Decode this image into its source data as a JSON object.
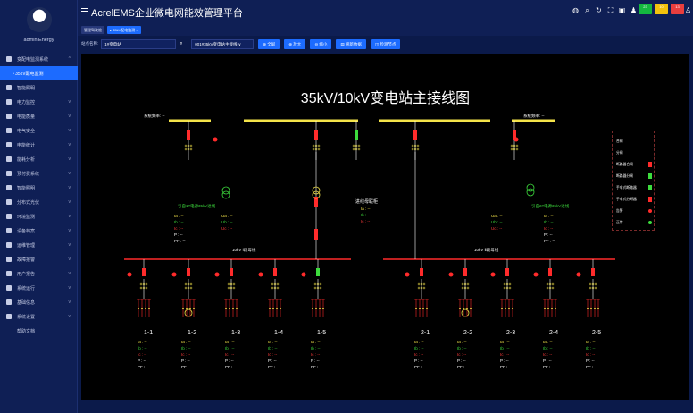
{
  "window": {
    "app_title": "AcrelEMS企业微电网能效管理平台",
    "user_name": "admin Energy"
  },
  "topbar": {
    "icons": [
      "globe-icon",
      "search-icon",
      "refresh-icon",
      "fullscreen-icon",
      "image-icon",
      "bell-icon"
    ],
    "badges": [
      {
        "label": "23",
        "color": "#14b83f"
      },
      {
        "label": "10",
        "color": "#f2c20d"
      },
      {
        "label": "13",
        "color": "#e83e3e"
      }
    ]
  },
  "sidebar": {
    "items": [
      {
        "label": "变配电监测系统",
        "icon": "home-icon",
        "chevron": "^"
      },
      {
        "label": "• 35kV配电监测",
        "icon": "",
        "chevron": "",
        "active": true,
        "sub": true
      },
      {
        "label": "智能照明",
        "icon": "bulb-icon",
        "chevron": ""
      },
      {
        "label": "电力监控",
        "icon": "monitor-icon",
        "chevron": "v"
      },
      {
        "label": "电能质量",
        "icon": "wave-icon",
        "chevron": "v"
      },
      {
        "label": "电气安全",
        "icon": "shield-icon",
        "chevron": "v"
      },
      {
        "label": "电能统计",
        "icon": "bar-chart-icon",
        "chevron": "v"
      },
      {
        "label": "能耗分析",
        "icon": "pie-icon",
        "chevron": "v"
      },
      {
        "label": "预付费系统",
        "icon": "card-icon",
        "chevron": "v"
      },
      {
        "label": "智能照明",
        "icon": "bulb-icon",
        "chevron": "v"
      },
      {
        "label": "分布式光伏",
        "icon": "solar-icon",
        "chevron": "v"
      },
      {
        "label": "环境监测",
        "icon": "tree-icon",
        "chevron": "v"
      },
      {
        "label": "设备档案",
        "icon": "folder-icon",
        "chevron": "v"
      },
      {
        "label": "运维管理",
        "icon": "tool-icon",
        "chevron": "v"
      },
      {
        "label": "故障报警",
        "icon": "alarm-icon",
        "chevron": "v"
      },
      {
        "label": "用户报告",
        "icon": "report-icon",
        "chevron": "v"
      },
      {
        "label": "系统运行",
        "icon": "run-icon",
        "chevron": "v"
      },
      {
        "label": "基础信息",
        "icon": "info-icon",
        "chevron": "v"
      },
      {
        "label": "系统设置",
        "icon": "settings-icon",
        "chevron": "v"
      },
      {
        "label": "帮助文档",
        "icon": "",
        "chevron": "",
        "plain": true
      }
    ]
  },
  "tabs": [
    {
      "label": "管理驾驶舱",
      "active": false
    },
    {
      "label": "▸ 35kV配电监测 ×",
      "active": true
    }
  ],
  "toolbar": {
    "station_label": "站点名称:",
    "station_value": "1#变电站",
    "diagram_select": "001#35kV变电站主接线 ∨",
    "buttons": [
      "⊕ 全屏",
      "⊕ 放大",
      "⊖ 缩小",
      "▤ 刷新数据",
      "◫ 检测节点"
    ]
  },
  "diagram": {
    "title": "35kV/10kV变电站主接线图",
    "freq_left": "系统频率: --",
    "freq_right": "系统频率: --",
    "incoming_left": "引自1#电源35kV进线",
    "incoming_right": "引自2#电源35kV进线",
    "pt_label": "进线母联柜",
    "bus_left": "10kV Ⅰ段母线",
    "bus_right": "10kV Ⅱ段母线",
    "meas_left": {
      "Ia": "Ia : --",
      "Ib": "Ib : --",
      "Ic": "Ic : --",
      "P": "P : --",
      "PF": "PF : --"
    },
    "meas_left2": {
      "Ua": "Ua : --",
      "Ub": "Ub : --",
      "Uc": "Uc : --"
    },
    "meas_mid": {
      "Ia": "Ia : --",
      "Ib": "Ib : --",
      "Ic": "Ic : --"
    },
    "meas_right2": {
      "Ua": "Ua : --",
      "Ub": "Ub : --",
      "Uc": "Uc : --"
    },
    "meas_right": {
      "Ia": "Ia : --",
      "Ib": "Ib : --",
      "Ic": "Ic : --",
      "P": "P : --",
      "PF": "PF : --"
    },
    "feeders": [
      {
        "name": "1-1"
      },
      {
        "name": "1-2"
      },
      {
        "name": "1-3"
      },
      {
        "name": "1-4"
      },
      {
        "name": "1-5"
      },
      {
        "name": "2-1"
      },
      {
        "name": "2-2"
      },
      {
        "name": "2-3"
      },
      {
        "name": "2-4"
      },
      {
        "name": "2-5"
      }
    ],
    "feeder_meas": {
      "Ia": "Ia : --",
      "Ib": "Ib : --",
      "Ic": "Ic : --",
      "P": "P : --",
      "PF": "PF : --"
    },
    "legend": [
      {
        "label": "合闸",
        "kind": "none",
        "color": "#ffffff"
      },
      {
        "label": "分闸",
        "kind": "none",
        "color": "#ffffff"
      },
      {
        "label": "断路器合闸",
        "kind": "sw",
        "color": "#ff2b2b"
      },
      {
        "label": "断路器分闸",
        "kind": "sw",
        "color": "#3ddc3d"
      },
      {
        "label": "手车式断路器",
        "kind": "sw",
        "color": "#3ddc3d"
      },
      {
        "label": "手车式分断器",
        "kind": "sw",
        "color": "#ff2b2b"
      },
      {
        "label": "告警",
        "kind": "dot",
        "color": "#ff2b2b"
      },
      {
        "label": "正常",
        "kind": "dot",
        "color": "#3ddc3d"
      }
    ]
  }
}
